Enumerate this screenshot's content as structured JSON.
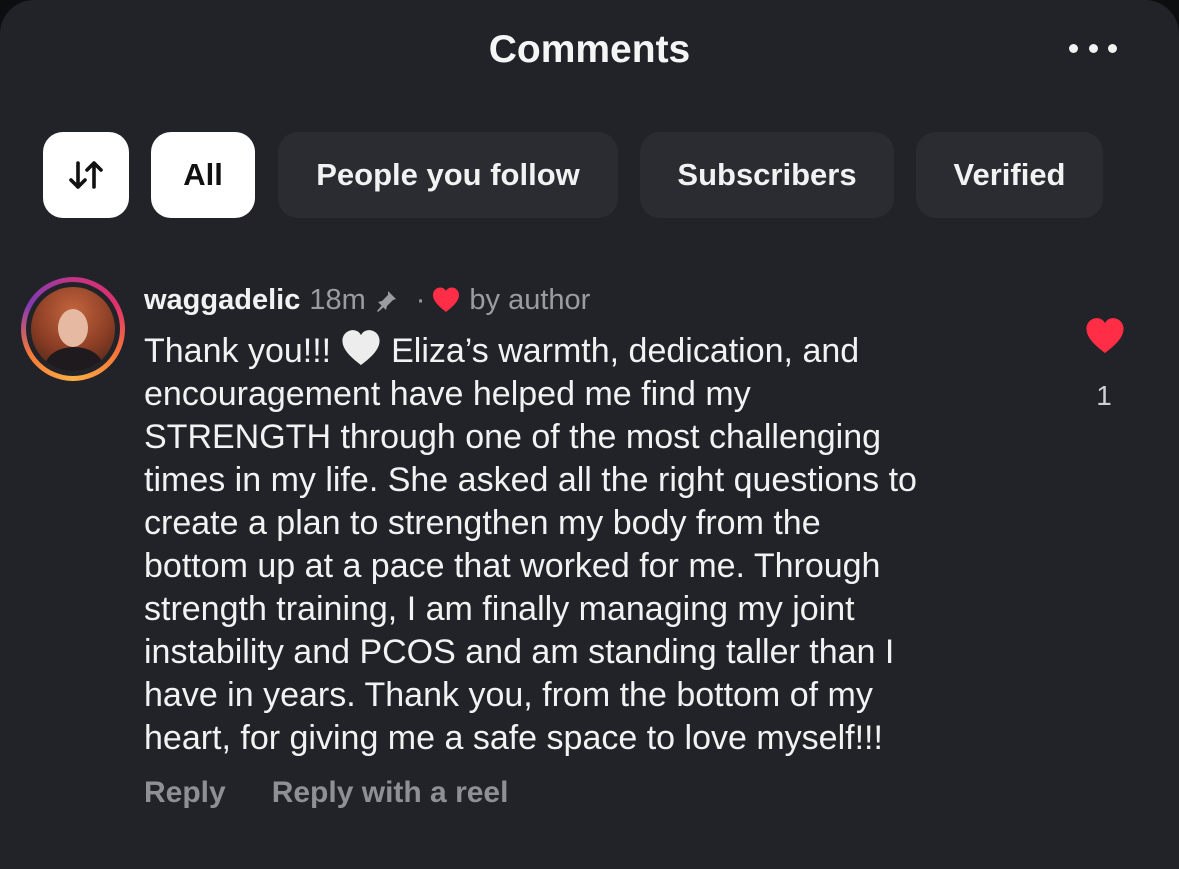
{
  "header": {
    "title": "Comments",
    "more_icon": "more-horizontal-icon"
  },
  "filters": {
    "sort_icon": "sort-arrows-icon",
    "chips": [
      "All",
      "People you follow",
      "Subscribers",
      "Verified"
    ],
    "active": "All"
  },
  "comment": {
    "username": "waggadelic",
    "time": "18m",
    "pin_icon": "pin-icon",
    "separator": "·",
    "liked_by_author_icon": "red-heart-icon",
    "liked_by_author_text": "by author",
    "lines": [
      "Thank you!!!",
      "Eliza’s warmth, dedication, and",
      "encouragement have helped me find my",
      "STRENGTH through one of the most challenging",
      "times in my life. She asked all the right questions to",
      "create a plan to strengthen my body from the",
      "bottom up at a pace that worked for me. Through",
      "strength training, I am finally managing my joint",
      "instability and PCOS and am standing taller than I",
      "have in years. Thank you, from the bottom of my",
      "heart, for giving me a safe space to love myself!!!"
    ],
    "inline_emoji": "white-heart-icon",
    "reply_label": "Reply",
    "reply_reel_label": "Reply with a reel",
    "like_count": "1",
    "like_icon": "red-heart-icon"
  },
  "colors": {
    "background": "#212328",
    "chip": "#2a2c31",
    "like": "#ff2d45",
    "muted": "#9a9ca1"
  }
}
